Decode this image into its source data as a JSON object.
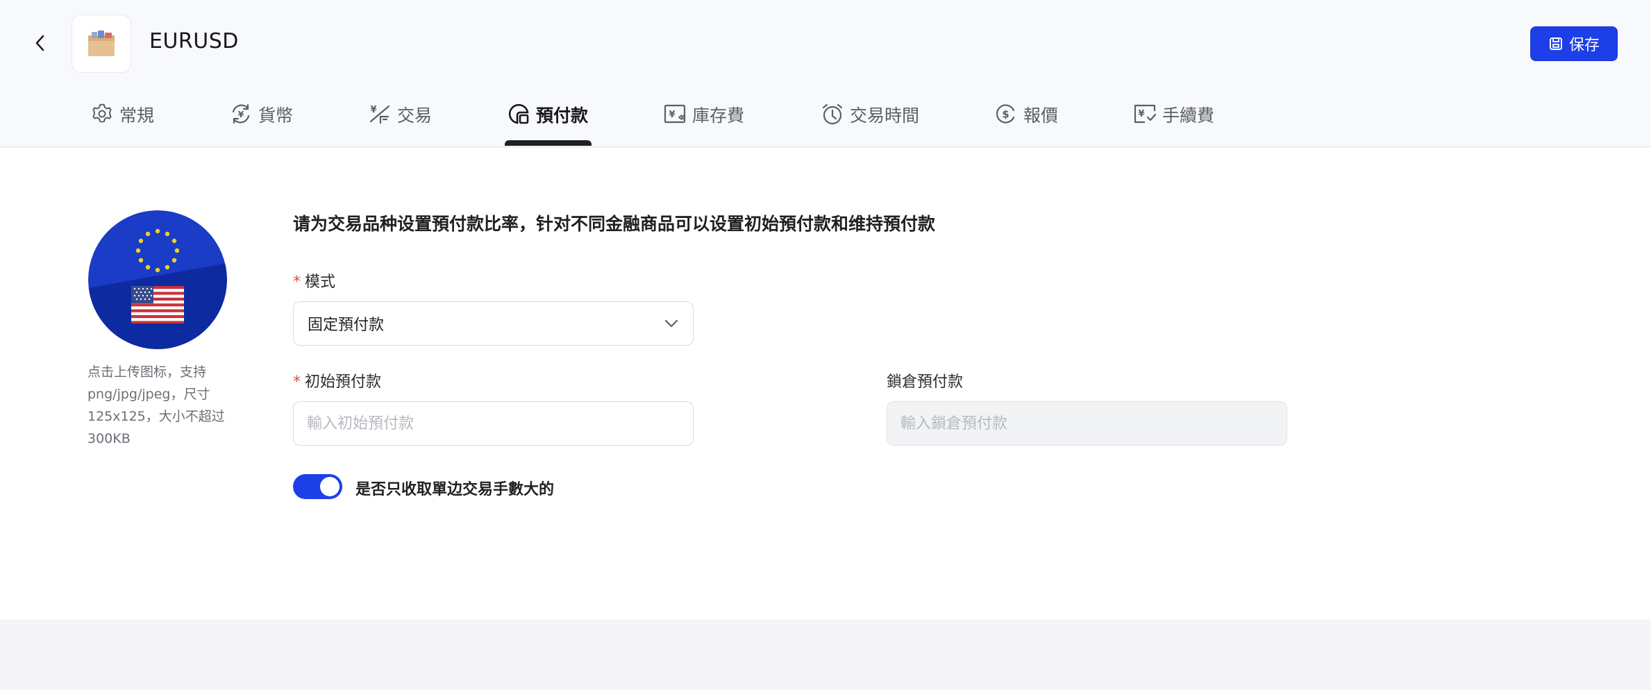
{
  "header": {
    "title": "EURUSD",
    "save_label": "保存"
  },
  "tabs": [
    {
      "label": "常規",
      "icon": "gear-icon"
    },
    {
      "label": "貨幣",
      "icon": "currency-exchange-icon"
    },
    {
      "label": "交易",
      "icon": "trade-icon"
    },
    {
      "label": "預付款",
      "icon": "margin-icon",
      "active": true
    },
    {
      "label": "庫存費",
      "icon": "swap-icon"
    },
    {
      "label": "交易時間",
      "icon": "clock-icon"
    },
    {
      "label": "報價",
      "icon": "dollar-coin-icon"
    },
    {
      "label": "手續費",
      "icon": "commission-icon"
    }
  ],
  "avatar": {
    "hint": "点击上传图标，支持png/jpg/jpeg，尺寸125x125，大小不超过300KB"
  },
  "form": {
    "description": "请为交易品种设置預付款比率，针对不同金融商品可以设置初始預付款和维持預付款",
    "mode": {
      "label": "模式",
      "required": "*",
      "value": "固定預付款"
    },
    "initial_margin": {
      "label": "初始預付款",
      "required": "*",
      "placeholder": "輸入初始預付款"
    },
    "hedged_margin": {
      "label": "鎖倉預付款",
      "placeholder": "輸入鎖倉預付款"
    },
    "one_side_commission": {
      "label": "是否只收取單边交易手數大的",
      "on": true
    }
  },
  "colors": {
    "accent": "#1d3fe8",
    "required": "#e5484d",
    "header_bg": "#f8f9fc"
  }
}
